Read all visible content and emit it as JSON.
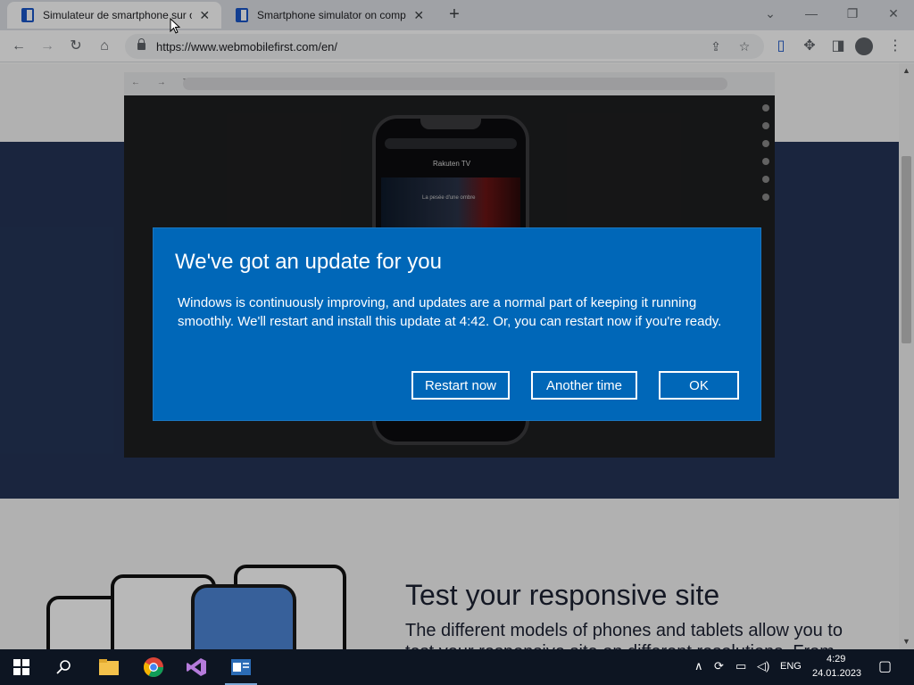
{
  "browser": {
    "tabs": [
      {
        "title": "Simulateur de smartphone sur ordinateur"
      },
      {
        "title": "Smartphone simulator on computer"
      }
    ],
    "url": "https://www.webmobilefirst.com/en/"
  },
  "page": {
    "feature_title": "Test your responsive site",
    "feature_text": "The different models of phones and tablets allow you to test your responsive site on different resolutions. From",
    "inner_phone": {
      "app_logo": "Rakuten TV",
      "poster_caption": "La pesée d'une ombre"
    }
  },
  "dialog": {
    "title": "We've got an update for you",
    "body": "Windows is continuously improving, and updates are a normal part of keeping it running smoothly. We'll restart and install this update at 4:42. Or, you can restart now if you're ready.",
    "buttons": {
      "restart_now": "Restart now",
      "another_time": "Another time",
      "ok": "OK"
    }
  },
  "taskbar": {
    "language": "ENG",
    "time": "4:29",
    "date": "24.01.2023"
  },
  "colors": {
    "dialog_bg": "#0067b8",
    "hero_bg": "#243457",
    "taskbar_bg": "#0d1522"
  }
}
